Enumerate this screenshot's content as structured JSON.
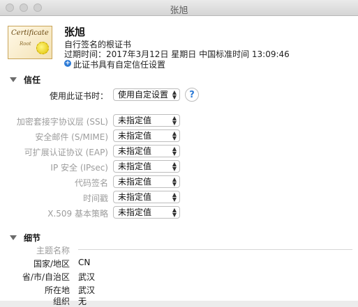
{
  "window": {
    "title": "张旭"
  },
  "header": {
    "name": "张旭",
    "type": "自行签名的根证书",
    "expiry": "过期时间：2017年3月12日 星期日 中国标准时间 13:09:46",
    "trust_note": "此证书具有自定信任设置",
    "cert_icon_text": "Certificate",
    "cert_icon_sub": "Root"
  },
  "trust": {
    "title": "信任",
    "when_using_label": "使用此证书时：",
    "when_using_value": "使用自定设置",
    "help": "?",
    "rows": [
      {
        "label": "加密套接字协议层 (SSL)",
        "value": "未指定值"
      },
      {
        "label": "安全邮件 (S/MIME)",
        "value": "未指定值"
      },
      {
        "label": "可扩展认证协议 (EAP)",
        "value": "未指定值"
      },
      {
        "label": "IP 安全 (IPsec)",
        "value": "未指定值"
      },
      {
        "label": "代码签名",
        "value": "未指定值"
      },
      {
        "label": "时间戳",
        "value": "未指定值"
      },
      {
        "label": "X.509 基本策略",
        "value": "未指定值"
      }
    ]
  },
  "details": {
    "title": "细节",
    "subject_heading": "主题名称",
    "rows": [
      {
        "label": "国家/地区",
        "value": "CN"
      },
      {
        "label": "省/市/自治区",
        "value": "武汉"
      },
      {
        "label": "所在地",
        "value": "武汉"
      },
      {
        "label": "组织",
        "value": "无"
      }
    ]
  },
  "colors": {
    "accent": "#2c7ad6"
  }
}
